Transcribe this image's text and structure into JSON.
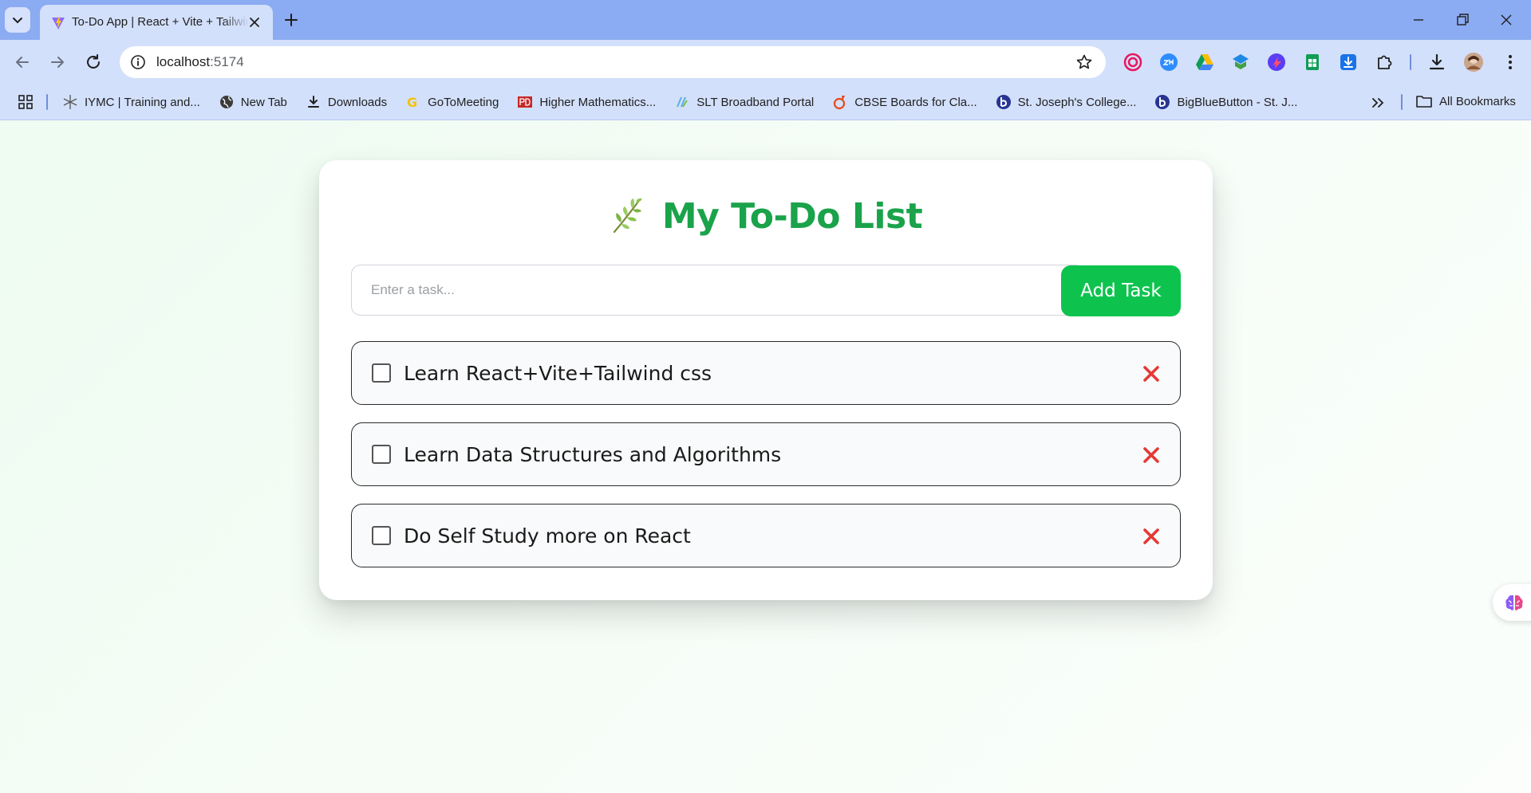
{
  "browser": {
    "tab": {
      "title": "To-Do App | React + Vite + Tailwind"
    },
    "address_bar": {
      "host": "localhost",
      "port": ":5174"
    },
    "bookmarks": [
      {
        "label": "IYMC | Training and...",
        "icon": "sparkle-icon"
      },
      {
        "label": "New Tab",
        "icon": "globe-icon"
      },
      {
        "label": "Downloads",
        "icon": "download-icon"
      },
      {
        "label": "GoToMeeting",
        "icon": "gotomeeting-icon"
      },
      {
        "label": "Higher Mathematics...",
        "icon": "pd-icon"
      },
      {
        "label": "SLT Broadband Portal",
        "icon": "slt-icon"
      },
      {
        "label": "CBSE Boards for Cla...",
        "icon": "cbse-icon"
      },
      {
        "label": "St. Joseph's College...",
        "icon": "bbb-icon"
      },
      {
        "label": "BigBlueButton - St. J...",
        "icon": "bbb-icon"
      }
    ],
    "all_bookmarks_label": "All Bookmarks"
  },
  "app": {
    "title": "My To-Do List",
    "title_icon": "sprout-icon",
    "input": {
      "placeholder": "Enter a task...",
      "value": ""
    },
    "add_button_label": "Add Task",
    "tasks": [
      {
        "text": "Learn React+Vite+Tailwind css",
        "done": false
      },
      {
        "text": "Learn Data Structures and Algorithms",
        "done": false
      },
      {
        "text": "Do Self Study more on React",
        "done": false
      }
    ]
  },
  "colors": {
    "accent_green": "#0dc34e",
    "title_green": "#1aa34a",
    "delete_red": "#e53935",
    "chrome_frame": "#8babf2",
    "chrome_toolbar": "#d3e0fb"
  }
}
